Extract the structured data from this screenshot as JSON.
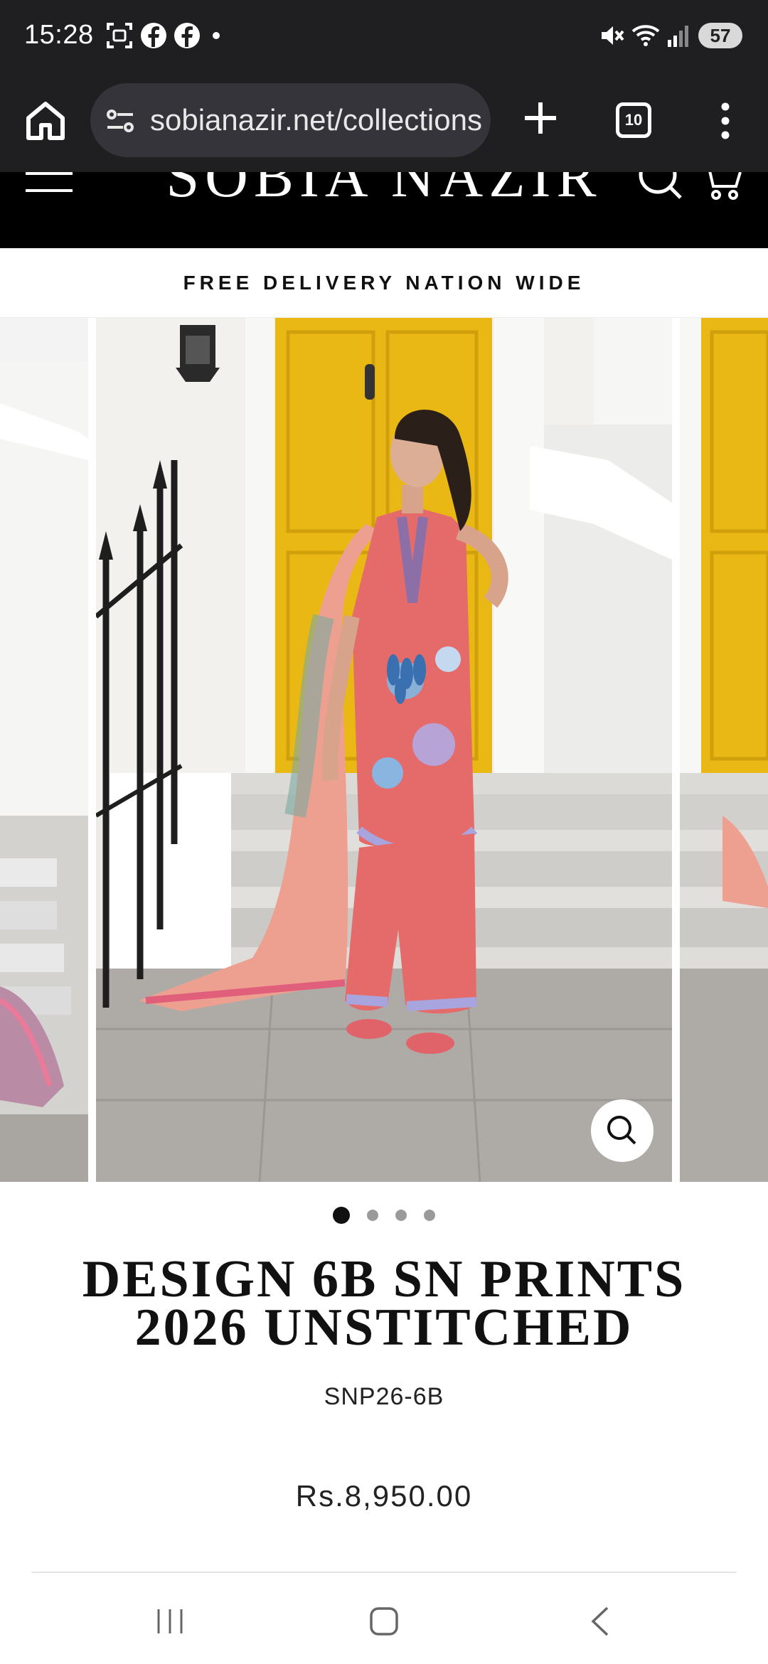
{
  "status_bar": {
    "time": "15:28",
    "battery": "57",
    "icons": [
      "screenshot-icon",
      "facebook-icon",
      "facebook-icon",
      "dot-icon",
      "mute-icon",
      "wifi-icon",
      "signal-icon"
    ]
  },
  "browser": {
    "url": "sobianazir.net/collections",
    "tab_count": "10",
    "icons": [
      "home-icon",
      "tune-icon",
      "plus-icon",
      "tabs-icon",
      "more-vert-icon"
    ]
  },
  "site": {
    "logo": "SOBIA NAZIR",
    "announcement": "FREE DELIVERY NATION WIDE"
  },
  "gallery": {
    "slide_count": 4,
    "active_slide": 0
  },
  "product": {
    "title": "DESIGN 6B SN PRINTS 2026 UNSTITCHED",
    "sku": "SNP26-6B",
    "price": "Rs.8,950.00"
  },
  "colors": {
    "chrome_dark": "#1f1f22",
    "url_pill": "#34343a",
    "door_yellow": "#e9b814",
    "outfit_coral": "#e56b6b"
  }
}
